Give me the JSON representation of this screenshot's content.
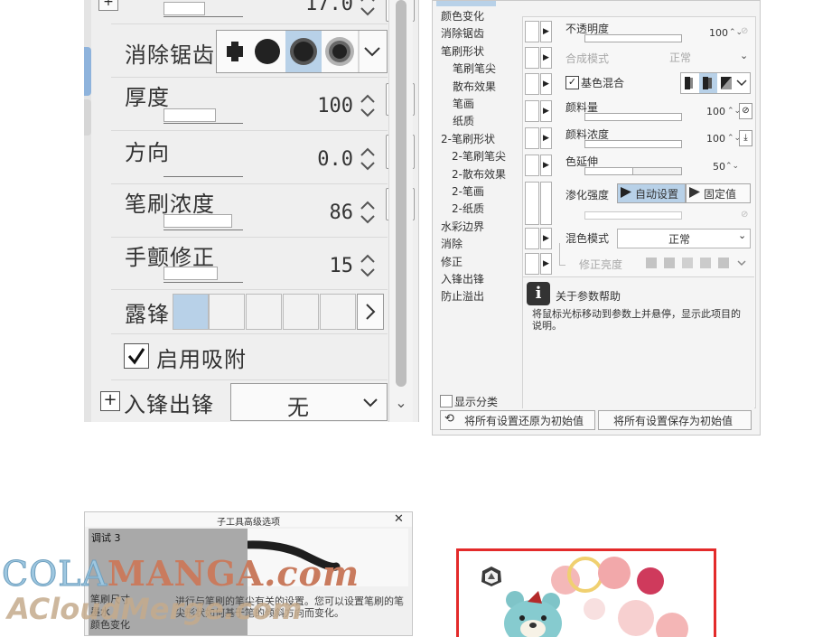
{
  "left_panel": {
    "top_value": "17.0",
    "antialias": {
      "label": "消除锯齿"
    },
    "thickness": {
      "label": "厚度",
      "value": "100"
    },
    "direction": {
      "label": "方向",
      "value": "0.0"
    },
    "brush_density": {
      "label": "笔刷浓度",
      "value": "86"
    },
    "stabilizer": {
      "label": "手颤修正",
      "value": "15"
    },
    "taper": {
      "label": "露锋"
    },
    "snap": {
      "label": "启用吸附",
      "checked": true
    },
    "pressure_in_out": {
      "label": "入锋出锋",
      "value": "无"
    },
    "colors": {
      "selected": "#b8d1e8",
      "panel": "#efefef"
    }
  },
  "right_panel": {
    "categories": [
      "颜色变化",
      "消除锯齿",
      "笔刷形状",
      "笔刷笔尖",
      "散布效果",
      "笔画",
      "纸质",
      "2-笔刷形状",
      "2-笔刷笔尖",
      "2-散布效果",
      "2-笔画",
      "2-纸质",
      "水彩边界",
      "消除",
      "修正",
      "入锋出锋",
      "防止溢出"
    ],
    "opacity": {
      "label": "不透明度",
      "value": "100"
    },
    "blend_mode_disabled": {
      "label": "合成模式",
      "value": "正常"
    },
    "base_color_blend": {
      "label": "基色混合",
      "checked": true
    },
    "paint_amount": {
      "label": "颜料量",
      "value": "100"
    },
    "paint_density": {
      "label": "颜料浓度",
      "value": "100"
    },
    "color_stretch": {
      "label": "色延伸",
      "value": "50"
    },
    "blur_strength": {
      "label": "渗化强度",
      "auto_label": "自动设置",
      "fixed_label": "固定值"
    },
    "mix_mode": {
      "label": "混色模式",
      "value": "正常"
    },
    "correct_brightness": {
      "label": "修正亮度"
    },
    "help": {
      "title": "关于参数帮助",
      "body": "将鼠标光标移动到参数上并悬停，显示此项目的说明。"
    },
    "show_categories": {
      "label": "显示分类",
      "checked": false
    },
    "reset_button": "将所有设置还原为初始值",
    "save_button": "将所有设置保存为初始值"
  },
  "dialog": {
    "title": "子工具高级选项",
    "tab": "调试 3",
    "categories": [
      "笔刷尺寸",
      "墨水",
      "颜色变化"
    ],
    "description": "进行与笔刷的笔尖有关的设置。您可以设置笔刷的笔尖形状如何基于笔的倾斜方向而变化。"
  },
  "watermark": {
    "line1_a": "COLA",
    "line1_b": "MANGA",
    "line1_c": ".com",
    "line2": "ACloudMerge.com"
  }
}
